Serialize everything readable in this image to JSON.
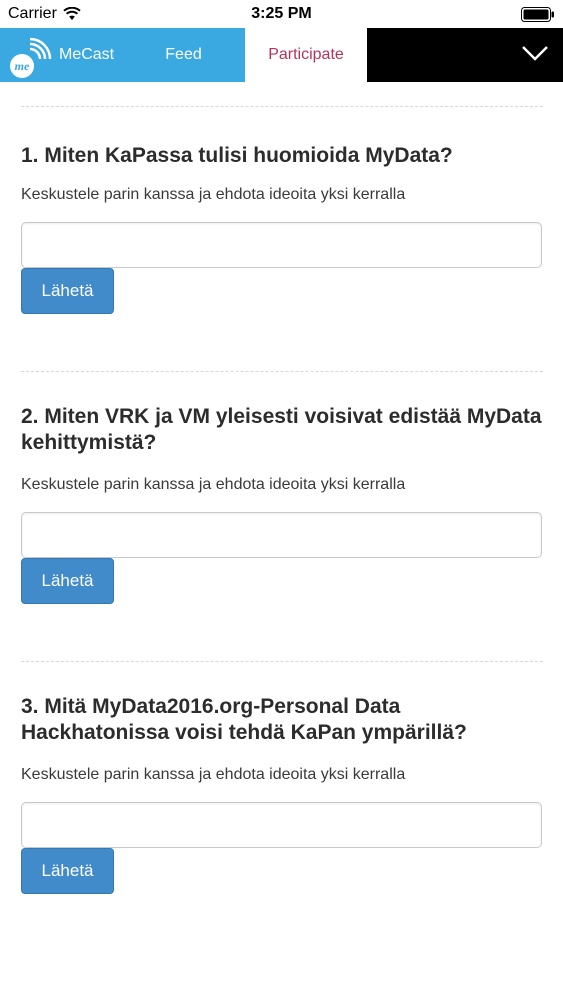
{
  "status_bar": {
    "carrier": "Carrier",
    "time": "3:25 PM",
    "wifi_icon": "wifi-icon",
    "battery_icon": "battery-icon"
  },
  "nav": {
    "brand_logo_text": "me",
    "brand_label": "MeCast",
    "feed_label": "Feed",
    "participate_label": "Participate",
    "menu_icon": "chevron-down-icon",
    "colors": {
      "brand_bg": "#3aa9e1",
      "active_text": "#b7335a",
      "menu_bg": "#000000"
    }
  },
  "questions": [
    {
      "title": "1. Miten KaPassa tulisi huomioida MyData?",
      "description": "Keskustele parin kanssa ja ehdota ideoita yksi kerralla",
      "input_value": "",
      "button_label": "Lähetä"
    },
    {
      "title": "2. Miten VRK ja VM yleisesti voisivat edistää MyData kehittymistä?",
      "description": "Keskustele parin kanssa ja ehdota ideoita yksi kerralla",
      "input_value": "",
      "button_label": "Lähetä"
    },
    {
      "title": "3. Mitä MyData2016.org-Personal Data Hackhatonissa voisi tehdä KaPan ympärillä?",
      "description": "Keskustele parin kanssa ja ehdota ideoita yksi kerralla",
      "input_value": "",
      "button_label": "Lähetä"
    }
  ],
  "colors": {
    "button_bg": "#428bca",
    "text": "#333333"
  }
}
